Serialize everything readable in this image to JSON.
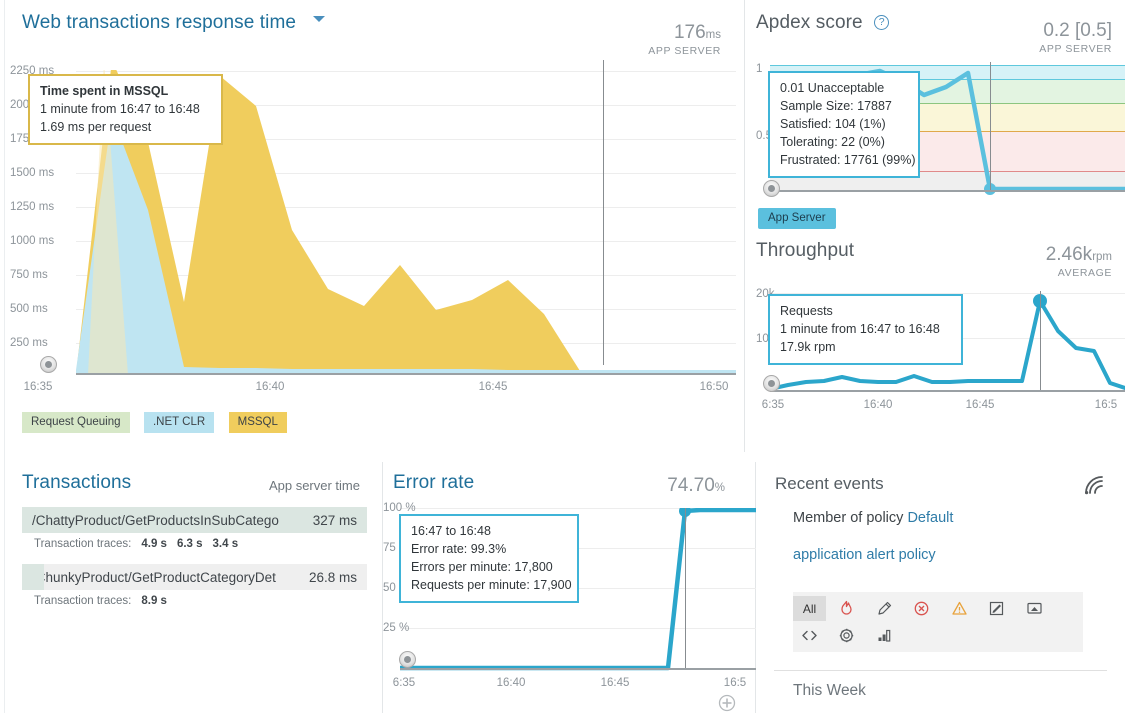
{
  "response_time": {
    "title": "Web transactions response time",
    "dropdown_icon": "chevron-down-icon",
    "metric_value": "176",
    "metric_unit": "ms",
    "metric_sub": "APP SERVER",
    "y_ticks": [
      "2250 ms",
      "2000 ms",
      "1750 ms",
      "1500 ms",
      "1250 ms",
      "1000 ms",
      "750 ms",
      "500 ms",
      "250 ms"
    ],
    "x_ticks": [
      "16:35",
      "16:40",
      "16:45",
      "16:50"
    ],
    "tooltip": {
      "title": "Time spent in MSSQL",
      "line2": "1 minute from 16:47 to 16:48",
      "line3": "1.69 ms per request"
    },
    "legend": [
      {
        "label": "Request Queuing",
        "color": "#d7e8c8"
      },
      {
        "label": ".NET CLR",
        "color": "#b8e2f0"
      },
      {
        "label": "MSSQL",
        "color": "#f0cd5d"
      }
    ]
  },
  "apdex": {
    "title": "Apdex score",
    "help_icon": "question-mark-icon",
    "metric_value": "0.2 [0.5]",
    "metric_sub": "APP SERVER",
    "y_ticks": [
      "1",
      "0.5"
    ],
    "tooltip": [
      "0.01 Unacceptable",
      "Sample Size: 17887",
      "Satisfied: 104 (1%)",
      "Tolerating: 22 (0%)",
      "Frustrated: 17761 (99%)"
    ],
    "pill_label": "App Server"
  },
  "throughput": {
    "title": "Throughput",
    "metric_value": "2.46k",
    "metric_unit": "rpm",
    "metric_sub": "AVERAGE",
    "y_ticks": [
      "20k",
      "10k"
    ],
    "x_ticks": [
      "6:35",
      "16:40",
      "16:45",
      "16:5"
    ],
    "tooltip": {
      "title": "Requests",
      "line2": "1 minute from 16:47 to 16:48",
      "line3": "17.9k rpm"
    }
  },
  "transactions": {
    "title": "Transactions",
    "column_label": "App server time",
    "traces_label": "Transaction traces:",
    "rows": [
      {
        "name": "/ChattyProduct/GetProductsInSubCatego",
        "value": "327 ms",
        "traces": [
          "4.9 s",
          "6.3 s",
          "3.4 s"
        ]
      },
      {
        "name": "/ChunkyProduct/GetProductCategoryDet",
        "value": "26.8 ms",
        "traces": [
          "8.9 s"
        ]
      }
    ]
  },
  "error_rate": {
    "title": "Error rate",
    "metric_value": "74.70",
    "metric_unit": "%",
    "y_ticks": [
      "100 %",
      "75 %",
      "50 %",
      "25 %"
    ],
    "x_ticks": [
      "6:35",
      "16:40",
      "16:45",
      "16:5"
    ],
    "tooltip": [
      "16:47 to 16:48",
      "Error rate: 99.3%",
      "Errors per minute: 17,800",
      "Requests per minute: 17,900"
    ],
    "add_icon": "circle-plus-icon"
  },
  "recent_events": {
    "title": "Recent events",
    "rss_icon": "rss-feed-icon",
    "event_text_1": "Member of policy ",
    "event_link_1": "Default",
    "event_link_2": "application alert policy",
    "filters": [
      {
        "name": "filter-all",
        "label": "All",
        "icon": "text",
        "selected": true
      },
      {
        "name": "filter-incident",
        "label": "",
        "icon": "flame-icon",
        "selected": false
      },
      {
        "name": "filter-marker",
        "label": "",
        "icon": "marker-icon",
        "selected": false
      },
      {
        "name": "filter-error",
        "label": "",
        "icon": "circle-x-icon",
        "selected": false
      },
      {
        "name": "filter-warning",
        "label": "",
        "icon": "warning-triangle-icon",
        "selected": false
      },
      {
        "name": "filter-note",
        "label": "",
        "icon": "edit-square-icon",
        "selected": false
      },
      {
        "name": "filter-deploy",
        "label": "",
        "icon": "deployment-icon",
        "selected": false
      },
      {
        "name": "filter-code",
        "label": "",
        "icon": "code-brackets-icon",
        "selected": false
      },
      {
        "name": "filter-config",
        "label": "",
        "icon": "gear-icon",
        "selected": false
      },
      {
        "name": "filter-report",
        "label": "",
        "icon": "bar-chart-icon",
        "selected": false
      }
    ],
    "section_label": "This Week"
  },
  "chart_data": [
    {
      "type": "area",
      "title": "Web transactions response time",
      "ylabel": "ms",
      "xlabel": "",
      "ylim": [
        0,
        2400
      ],
      "xlim": [
        "16:34",
        "16:51"
      ],
      "grid": true,
      "legend_position": "bottom-left",
      "stacked": true,
      "x": [
        "16:34",
        "16:35",
        "16:36",
        "16:37",
        "16:38",
        "16:39",
        "16:40",
        "16:41",
        "16:42",
        "16:43",
        "16:44",
        "16:45",
        "16:46",
        "16:47",
        "16:48",
        "16:49",
        "16:50",
        "16:51"
      ],
      "series": [
        {
          "name": "Request Queuing",
          "color": "#d7e8c8",
          "values": [
            5,
            8,
            6,
            5,
            5,
            5,
            5,
            5,
            5,
            5,
            5,
            5,
            5,
            4,
            3,
            3,
            3,
            3
          ]
        },
        {
          "name": ".NET CLR",
          "color": "#b8e2f0",
          "values": [
            60,
            1900,
            1350,
            40,
            30,
            25,
            22,
            20,
            20,
            18,
            18,
            16,
            15,
            14,
            12,
            12,
            12,
            12
          ]
        },
        {
          "name": "MSSQL",
          "color": "#f0cd5d",
          "values": [
            0,
            330,
            1800,
            1250,
            1850,
            1700,
            1000,
            430,
            360,
            560,
            330,
            390,
            520,
            430,
            1.69,
            4,
            4,
            4
          ]
        }
      ]
    },
    {
      "type": "line",
      "title": "Apdex score",
      "ylim": [
        0,
        1
      ],
      "y_ticks": [
        1,
        0.5
      ],
      "grid": true,
      "bands": [
        {
          "label": "excellent",
          "from": 0.94,
          "to": 1.0,
          "color": "#d6f2f7"
        },
        {
          "label": "good",
          "from": 0.85,
          "to": 0.94,
          "color": "#e2f3e0"
        },
        {
          "label": "fair",
          "from": 0.7,
          "to": 0.85,
          "color": "#faf6d8"
        },
        {
          "label": "poor",
          "from": 0.5,
          "to": 0.7,
          "color": "#fbe9e9"
        }
      ],
      "series": [
        {
          "name": "App Server",
          "color": "#5bc0de",
          "values": [
            0.92,
            0.9,
            0.88,
            0.91,
            0.97,
            0.95,
            0.93,
            0.9,
            0.94,
            0.01,
            0.01,
            0.01,
            0.01
          ]
        }
      ],
      "highlight_point": {
        "label": "0.01 Unacceptable",
        "sample_size": 17887,
        "satisfied": 104,
        "satisfied_pct": 1,
        "tolerating": 22,
        "tolerating_pct": 0,
        "frustrated": 17761,
        "frustrated_pct": 99
      }
    },
    {
      "type": "line",
      "title": "Throughput",
      "ylabel": "rpm",
      "ylim": [
        0,
        22000
      ],
      "y_ticks": [
        20000,
        10000
      ],
      "x_ticks": [
        "6:35",
        "16:40",
        "16:45",
        "16:5"
      ],
      "grid": true,
      "series": [
        {
          "name": "Requests",
          "color": "#2ba6cb",
          "values": [
            200,
            600,
            900,
            1000,
            1700,
            1000,
            950,
            900,
            1600,
            900,
            900,
            1000,
            17900,
            12000,
            9000,
            3000
          ]
        }
      ],
      "highlight_point": {
        "time": "16:47 to 16:48",
        "value": 17900,
        "label": "17.9k rpm"
      }
    },
    {
      "type": "line",
      "title": "Error rate",
      "ylabel": "%",
      "ylim": [
        0,
        105
      ],
      "y_ticks": [
        100,
        75,
        50,
        25
      ],
      "x_ticks": [
        "6:35",
        "16:40",
        "16:45",
        "16:5"
      ],
      "grid": true,
      "series": [
        {
          "name": "Error rate",
          "color": "#2ba6cb",
          "values": [
            0.2,
            0.2,
            0.2,
            0.2,
            0.2,
            0.2,
            0.2,
            0.2,
            0.2,
            0.2,
            0.2,
            0.2,
            99.3,
            99.5,
            99.5,
            99.5
          ]
        }
      ],
      "highlight_point": {
        "time": "16:47 to 16:48",
        "error_rate": 99.3,
        "errors_per_minute": 17800,
        "requests_per_minute": 17900
      }
    }
  ]
}
